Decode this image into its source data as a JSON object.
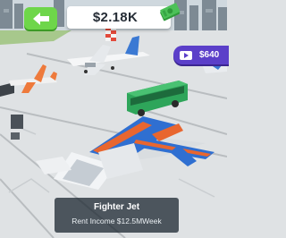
{
  "hud": {
    "money": "$2.18K",
    "back_icon": "arrow-left-icon",
    "cash_icon": "cash-stack-icon"
  },
  "ad_button": {
    "label": "$640",
    "icon": "video-play-icon"
  },
  "info_card": {
    "title": "Fighter Jet",
    "income": "Rent Income $12.5MWeek"
  },
  "colors": {
    "back_button": "#6ed64a",
    "ad_button": "#5b3fc9",
    "bus": "#2ea55a",
    "fighter_blue": "#2f6fd1",
    "fighter_orange": "#e8662f",
    "tarmac": "#dfe2e4"
  }
}
